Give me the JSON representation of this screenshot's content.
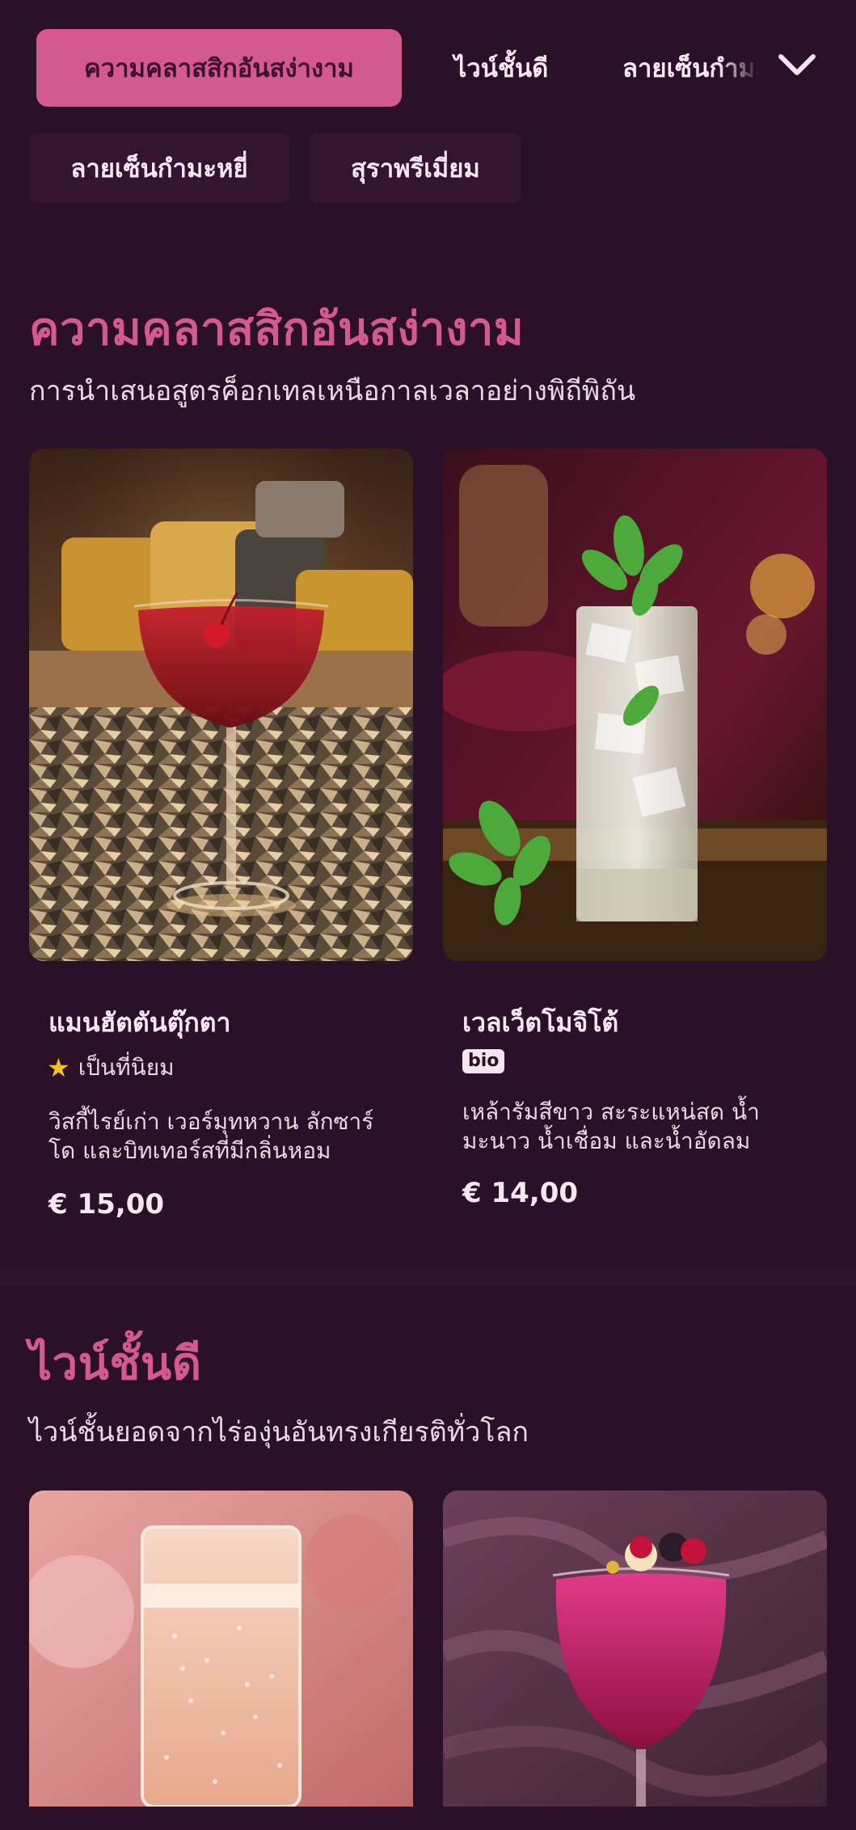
{
  "tabs": {
    "items": [
      {
        "label": "ความคลาสสิกอันสง่างาม"
      },
      {
        "label": "ไวน์ชั้นดี"
      },
      {
        "label": "ลายเซ็นกำมะหยี่"
      }
    ],
    "active_index": 0,
    "secondary": [
      {
        "label": "ลายเซ็นกำมะหยี่"
      },
      {
        "label": "สุราพรีเมี่ยม"
      }
    ],
    "more_icon": "chevron-down-icon"
  },
  "sections": [
    {
      "title": "ความคลาสสิกอันสง่างาม",
      "subtitle": "การนำเสนอสูตรค็อกเทลเหนือกาลเวลาอย่างพิถีพิถัน",
      "items": [
        {
          "name": "แมนฮัตตันตุ๊กตา",
          "badge": "เป็นที่นิยม",
          "badge_icon": "star-icon",
          "desc_lines": [
            "วิสกี้ไรย์เก่า เวอร์มุทหวาน ลักซาร์",
            "โด และบิทเทอร์สที่มีกลิ่นหอม"
          ],
          "price": "€ 15,00"
        },
        {
          "name": "เวลเว็ตโมจิโต้",
          "badge": "bio",
          "desc_lines": [
            "เหล้ารัมสีขาว สะระแหน่สด น้ำ",
            "มะนาว น้ำเชื่อม และน้ำอัดลม"
          ],
          "price": "€ 14,00"
        }
      ]
    },
    {
      "title": "ไวน์ชั้นดี",
      "subtitle": "ไวน์ชั้นยอดจากไร่องุ่นอันทรงเกียรติทั่วโลก"
    }
  ],
  "colors": {
    "background": "#2a1127",
    "accent": "#d45a8e",
    "chip": "#34142f",
    "star": "#f6c21a"
  }
}
